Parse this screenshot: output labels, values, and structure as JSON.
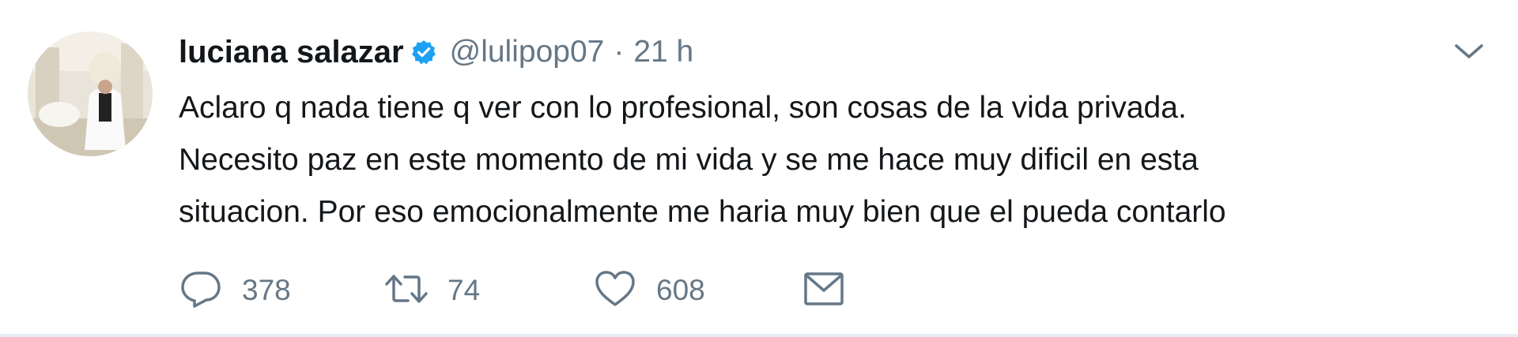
{
  "user": {
    "name": "luciana salazar",
    "handle": "@lulipop07",
    "separator": "·",
    "time": "21 h"
  },
  "tweet": {
    "lines": [
      "Aclaro q nada tiene q ver con lo profesional, son cosas de la vida privada.",
      "Necesito paz en este momento de mi vida y se me hace muy dificil en esta",
      "situacion. Por eso emocionalmente me haria muy bien que el pueda contarlo"
    ]
  },
  "actions": {
    "replies": "378",
    "retweets": "74",
    "likes": "608"
  },
  "icons": {
    "verified": "verified-badge-icon",
    "caret": "chevron-down-icon",
    "reply": "reply-bubble-icon",
    "retweet": "retweet-icon",
    "like": "heart-icon",
    "message": "envelope-icon"
  },
  "colors": {
    "verified_blue": "#1da1f2",
    "secondary_text": "#657786",
    "primary_text": "#14171a",
    "divider": "#e6ecf0"
  }
}
